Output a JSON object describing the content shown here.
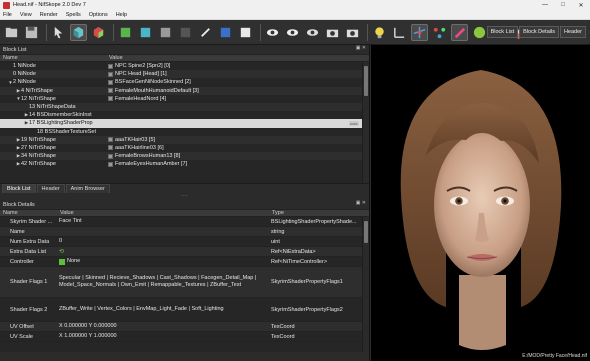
{
  "window": {
    "title": "Head.nif - NifSkope 2.0 Dev 7",
    "controls": [
      "—",
      "□",
      "✕"
    ]
  },
  "menu": [
    "File",
    "View",
    "Render",
    "Spells",
    "Options",
    "Help"
  ],
  "toolbar": {
    "buttons": [
      "load-icon",
      "save-icon",
      "cube-icon",
      "cube-icon",
      "cube-icon",
      "cube-icon",
      "light-icon",
      "eye-icon",
      "eye-icon",
      "eye-icon",
      "camera-icon",
      "camera-icon",
      "bulb-icon",
      "axis-icon",
      "nodes-icon",
      "pin-icon",
      "green-icon",
      "red-icon",
      "eraser-icon"
    ],
    "dock_tabs": [
      "Block List",
      "Block Details",
      "Header"
    ]
  },
  "block_list": {
    "title": "Block List",
    "columns": {
      "name": "Name",
      "value": "Value"
    },
    "rows": [
      {
        "name": "1 NiNode",
        "value": "NPC Spine2 [Spn2] [0]",
        "indent": 0,
        "arrow": "",
        "selected": false
      },
      {
        "name": "0 NiNode",
        "value": "NPC Head [Head] [1]",
        "indent": 0,
        "arrow": "",
        "selected": false
      },
      {
        "name": "2 NiNode",
        "value": "BSFaceGenNiNodeSkinned [2]",
        "indent": 0,
        "arrow": "▼",
        "selected": false
      },
      {
        "name": "4 NiTriShape",
        "value": "FemaleMouthHumanoidDefault [3]",
        "indent": 1,
        "arrow": "▶",
        "selected": false
      },
      {
        "name": "12 NiTriShape",
        "value": "FemaleHeadNord [4]",
        "indent": 1,
        "arrow": "▼",
        "selected": false
      },
      {
        "name": "13 NiTriShapeData",
        "value": "",
        "indent": 2,
        "arrow": "",
        "selected": false
      },
      {
        "name": "14 BSDismemberSkinInst",
        "value": "",
        "indent": 2,
        "arrow": "▶",
        "selected": false
      },
      {
        "name": "17 BSLightingShaderProp",
        "value": "",
        "indent": 2,
        "arrow": "▶",
        "selected": true
      },
      {
        "name": "18 BSShaderTextureSet",
        "value": "",
        "indent": 3,
        "arrow": "",
        "selected": false
      },
      {
        "name": "19 NiTriShape",
        "value": "aaaTKHair03 [5]",
        "indent": 1,
        "arrow": "▶",
        "selected": false
      },
      {
        "name": "27 NiTriShape",
        "value": "aaaTKHairline03 [6]",
        "indent": 1,
        "arrow": "▶",
        "selected": false
      },
      {
        "name": "34 NiTriShape",
        "value": "FemaleBrowsHuman13 [8]",
        "indent": 1,
        "arrow": "▶",
        "selected": false
      },
      {
        "name": "42 NiTriShape",
        "value": "FemaleEyesHumanAmber [7]",
        "indent": 1,
        "arrow": "▶",
        "selected": false
      }
    ]
  },
  "bottom_tabs": [
    "Block List",
    "Header",
    "Anim Browser"
  ],
  "block_details": {
    "title": "Block Details",
    "columns": {
      "name": "Name",
      "value": "Value",
      "type": "Type"
    },
    "rows": [
      {
        "name": "Skyrim Shader ...",
        "value": "Face Tint",
        "type": "BSLightingShaderPropertyShade...",
        "icon": "",
        "lines": 1
      },
      {
        "name": "Name",
        "value": "",
        "type": "string",
        "icon": "",
        "lines": 1
      },
      {
        "name": "Num Extra Data",
        "value": "0",
        "type": "uint",
        "icon": "",
        "lines": 1
      },
      {
        "name": "Extra Data List",
        "value": "",
        "type": "Ref<NiExtraData>",
        "icon": "arrows-icon",
        "lines": 1
      },
      {
        "name": "Controller",
        "value": "None",
        "type": "Ref<NiTimeController>",
        "icon": "plus-icon",
        "lines": 1
      },
      {
        "name": "Shader Flags 1",
        "value": "Specular | Skinned | Recieve_Shadows | Cast_Shadows | Facegen_Detail_Map | Model_Space_Normals | Own_Emit | Remappable_Textures | ZBuffer_Test",
        "type": "SkyrimShaderPropertyFlags1",
        "icon": "",
        "lines": 4
      },
      {
        "name": "Shader Flags 2",
        "value": "ZBuffer_Write | Vertex_Colors | EnvMap_Light_Fade | Soft_Lighting",
        "type": "SkyrimShaderPropertyFlags2",
        "icon": "",
        "lines": 3
      },
      {
        "name": "UV Offset",
        "value": "X 0.000000 Y 0.000000",
        "type": "TexCoord",
        "icon": "",
        "lines": 1
      },
      {
        "name": "UV Scale",
        "value": "X 1.000000 Y 1.000000",
        "type": "TexCoord",
        "icon": "",
        "lines": 1
      }
    ]
  },
  "viewport": {
    "status_path": "E:/MOD/Pretty Face/Head.nif"
  },
  "colors": {
    "selection": "#d9d9d9",
    "panel": "#2b2b2b",
    "viewport": "#000000"
  }
}
